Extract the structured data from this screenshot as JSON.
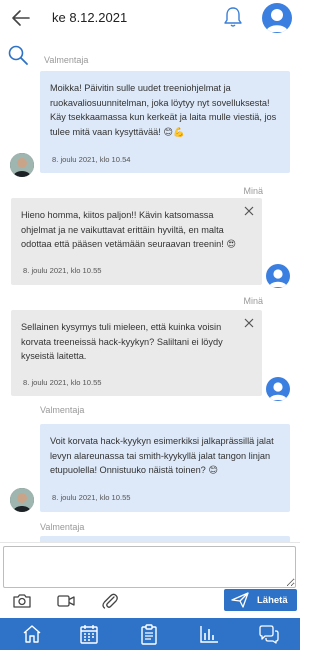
{
  "header": {
    "title": "ke 8.12.2021"
  },
  "messages": [
    {
      "sender": "Valmentaja",
      "text": "Moikka! Päivitin sulle uudet treeniohjelmat ja ruokavaliosuunnitelman, joka löytyy nyt sovelluksesta! Käy tsekkaamassa kun kerkeät ja laita mulle viestiä, jos tulee mitä vaan kysyttävää! 😊💪",
      "time": "8. joulu 2021, klo 10.54"
    },
    {
      "sender": "Minä",
      "text": "Hieno homma, kiitos paljon!! Kävin katsomassa ohjelmat ja ne vaikuttavat erittäin hyviltä, en malta odottaa että pääsen vetämään seuraavan treenin! 😍",
      "time": "8. joulu 2021, klo 10.55"
    },
    {
      "sender": "Minä",
      "text": "Sellainen kysymys tuli mieleen, että kuinka voisin korvata treeneissä hack-kyykyn? Saliltani ei löydy kyseistä laitetta.",
      "time": "8. joulu 2021, klo 10.55"
    },
    {
      "sender": "Valmentaja",
      "text": "Voit korvata hack-kyykyn esimerkiksi jalkaprässillä jalat levyn alareunassa tai smith-kyykyllä jalat tangon linjan etupuolella! Onnistuuko näistä toinen? 😊",
      "time": "8. joulu 2021, klo 10.55"
    },
    {
      "sender": "Valmentaja"
    }
  ],
  "composer": {
    "placeholder": "",
    "send_label": "Lähetä"
  },
  "icons": {
    "back": "arrow-left-icon",
    "notifications": "bell-icon",
    "search": "search-icon",
    "camera": "camera-icon",
    "video": "video-icon",
    "attach": "paperclip-icon",
    "send": "send-icon",
    "tabs": [
      "home-icon",
      "calendar-icon",
      "clipboard-icon",
      "chart-icon",
      "chat-icon"
    ]
  },
  "colors": {
    "accent": "#2e73c8",
    "incoming_bubble": "#dde9f8",
    "outgoing_bubble": "#eaeaea",
    "avatar": "#3b7fe0"
  }
}
